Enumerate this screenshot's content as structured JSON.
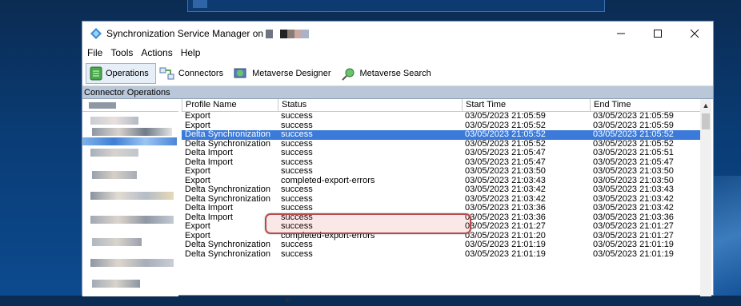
{
  "window": {
    "title": "Synchronization Service Manager on",
    "minimize_icon": "minimize-icon",
    "maximize_icon": "maximize-icon",
    "close_icon": "close-icon"
  },
  "menu": [
    "File",
    "Tools",
    "Actions",
    "Help"
  ],
  "toolbar": [
    {
      "label": "Operations",
      "icon": "operations-icon"
    },
    {
      "label": "Connectors",
      "icon": "connectors-icon"
    },
    {
      "label": "Metaverse Designer",
      "icon": "metaverse-designer-icon"
    },
    {
      "label": "Metaverse Search",
      "icon": "metaverse-search-icon"
    }
  ],
  "section_title": "Connector Operations",
  "table": {
    "columns": [
      "Profile Name",
      "Status",
      "Start Time",
      "End Time"
    ],
    "rows": [
      {
        "profile": "Export",
        "status": "success",
        "start": "03/05/2023 21:05:59",
        "end": "03/05/2023 21:05:59"
      },
      {
        "profile": "Export",
        "status": "success",
        "start": "03/05/2023 21:05:52",
        "end": "03/05/2023 21:05:59"
      },
      {
        "profile": "Delta Synchronization",
        "status": "success",
        "start": "03/05/2023 21:05:52",
        "end": "03/05/2023 21:05:52",
        "selected": true
      },
      {
        "profile": "Delta Synchronization",
        "status": "success",
        "start": "03/05/2023 21:05:52",
        "end": "03/05/2023 21:05:52"
      },
      {
        "profile": "Delta Import",
        "status": "success",
        "start": "03/05/2023 21:05:47",
        "end": "03/05/2023 21:05:51"
      },
      {
        "profile": "Delta Import",
        "status": "success",
        "start": "03/05/2023 21:05:47",
        "end": "03/05/2023 21:05:47"
      },
      {
        "profile": "Export",
        "status": "success",
        "start": "03/05/2023 21:03:50",
        "end": "03/05/2023 21:03:50"
      },
      {
        "profile": "Export",
        "status": "completed-export-errors",
        "start": "03/05/2023 21:03:43",
        "end": "03/05/2023 21:03:50"
      },
      {
        "profile": "Delta Synchronization",
        "status": "success",
        "start": "03/05/2023 21:03:42",
        "end": "03/05/2023 21:03:43"
      },
      {
        "profile": "Delta Synchronization",
        "status": "success",
        "start": "03/05/2023 21:03:42",
        "end": "03/05/2023 21:03:42"
      },
      {
        "profile": "Delta Import",
        "status": "success",
        "start": "03/05/2023 21:03:36",
        "end": "03/05/2023 21:03:42"
      },
      {
        "profile": "Delta Import",
        "status": "success",
        "start": "03/05/2023 21:03:36",
        "end": "03/05/2023 21:03:36"
      },
      {
        "profile": "Export",
        "status": "success",
        "start": "03/05/2023 21:01:27",
        "end": "03/05/2023 21:01:27"
      },
      {
        "profile": "Export",
        "status": "completed-export-errors",
        "start": "03/05/2023 21:01:20",
        "end": "03/05/2023 21:01:27"
      },
      {
        "profile": "Delta Synchronization",
        "status": "success",
        "start": "03/05/2023 21:01:19",
        "end": "03/05/2023 21:01:19"
      },
      {
        "profile": "Delta Synchronization",
        "status": "success",
        "start": "03/05/2023 21:01:19",
        "end": "03/05/2023 21:01:19"
      }
    ]
  },
  "colors": {
    "selection": "#3b7ad8",
    "highlight_border": "#b74a4a"
  }
}
